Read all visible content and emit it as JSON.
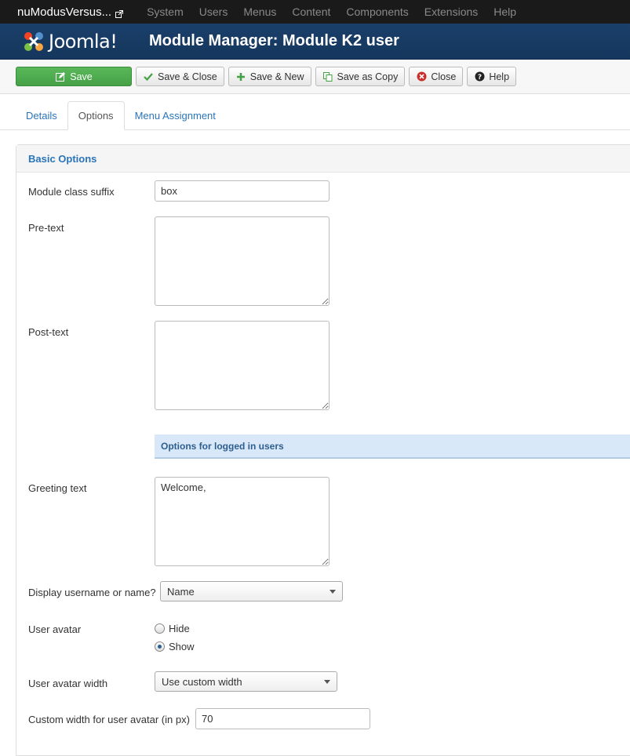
{
  "topnav": {
    "site_name": "nuModusVersus...",
    "menu": [
      "System",
      "Users",
      "Menus",
      "Content",
      "Components",
      "Extensions",
      "Help"
    ]
  },
  "header": {
    "logo_text": "Joomla!",
    "title": "Module Manager: Module K2 user"
  },
  "toolbar": {
    "save": "Save",
    "save_close": "Save & Close",
    "save_new": "Save & New",
    "save_copy": "Save as Copy",
    "close": "Close",
    "help": "Help"
  },
  "tabs": [
    "Details",
    "Options",
    "Menu Assignment"
  ],
  "panel": {
    "title": "Basic Options",
    "module_class_suffix": {
      "label": "Module class suffix",
      "value": "box"
    },
    "pre_text": {
      "label": "Pre-text",
      "value": ""
    },
    "post_text": {
      "label": "Post-text",
      "value": ""
    },
    "logged_in_heading": "Options for logged in users",
    "greeting_text": {
      "label": "Greeting text",
      "value": "Welcome,"
    },
    "display_name": {
      "label": "Display username or name?",
      "value": "Name"
    },
    "user_avatar": {
      "label": "User avatar",
      "options": [
        "Hide",
        "Show"
      ],
      "selected": "Show"
    },
    "user_avatar_width": {
      "label": "User avatar width",
      "value": "Use custom width"
    },
    "custom_width": {
      "label": "Custom width for user avatar (in px)",
      "value": "70"
    }
  },
  "colors": {
    "topnav_bg": "#1a1a1a",
    "header_bg": "#15375d",
    "save_green": "#46a046",
    "link_blue": "#2a74b9"
  }
}
